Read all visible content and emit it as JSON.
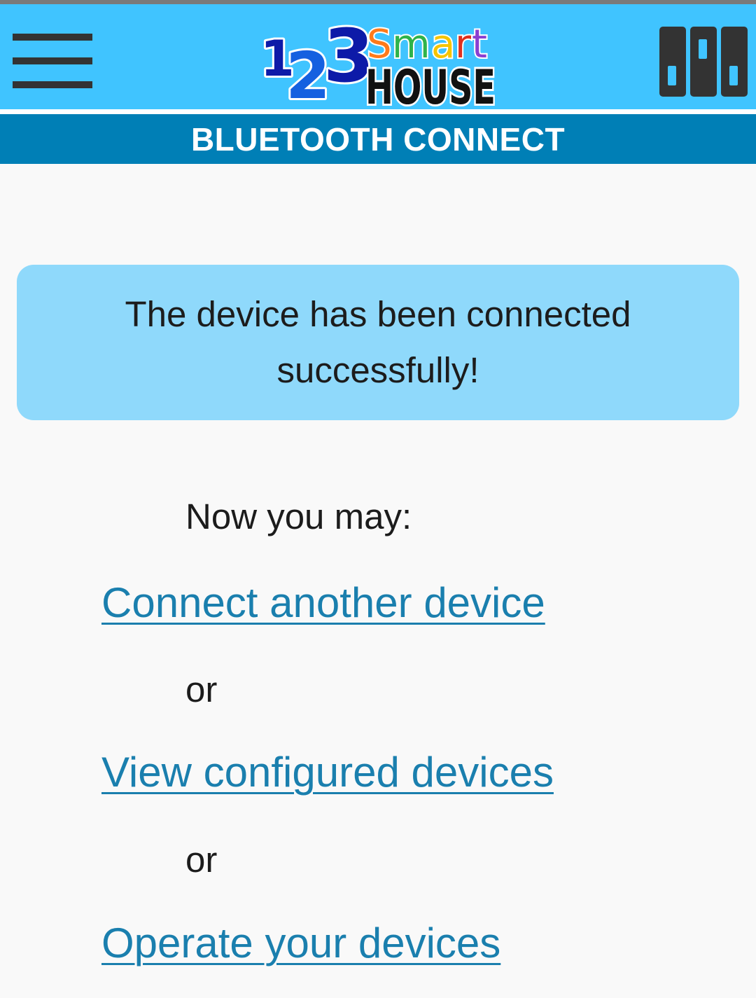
{
  "header": {
    "menu_icon": "hamburger-menu-icon",
    "logo": {
      "number_text": "123",
      "word_top": "Smart",
      "word_bottom": "HOUSE"
    },
    "grid_icon": "device-grid-icon"
  },
  "page_title": "BLUETOOTH CONNECT",
  "alert": {
    "message": "The device has been connected successfully!"
  },
  "content": {
    "intro": "Now you may:",
    "links": [
      "Connect another device",
      "View configured devices",
      "Operate your devices"
    ],
    "separator": "or"
  },
  "colors": {
    "header_bg": "#40c4ff",
    "title_bar_bg": "#007fb6",
    "alert_bg": "#8fd9fb",
    "link": "#1a7fae"
  }
}
